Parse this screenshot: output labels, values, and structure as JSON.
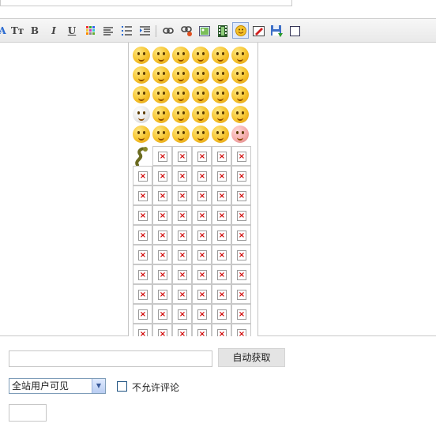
{
  "toolbar": {
    "items": [
      {
        "icon": "font-icon"
      },
      {
        "icon": "font-size-icon",
        "label": "Tт"
      },
      {
        "icon": "bold-icon",
        "label": "B"
      },
      {
        "icon": "italic-icon",
        "label": "I"
      },
      {
        "icon": "underline-icon",
        "label": "U"
      },
      {
        "icon": "color-icon"
      },
      {
        "icon": "align-icon"
      },
      {
        "icon": "unordered-list-icon"
      },
      {
        "icon": "indent-icon"
      },
      {
        "icon": "link-icon"
      },
      {
        "icon": "unlink-icon"
      },
      {
        "icon": "image-icon"
      },
      {
        "icon": "video-icon"
      },
      {
        "icon": "emoticon-icon",
        "active": true
      },
      {
        "icon": "clear-format-icon"
      },
      {
        "icon": "save-icon"
      },
      {
        "icon": "source-icon"
      }
    ]
  },
  "emoticons": {
    "icon": "emoticon-face-icon",
    "broken_icon": "broken-image-icon",
    "broken_glyph": "×"
  },
  "form": {
    "fetch_button": "自动获取",
    "visibility_selected": "全站用户可见",
    "no_comment_label": "不允许评论"
  }
}
